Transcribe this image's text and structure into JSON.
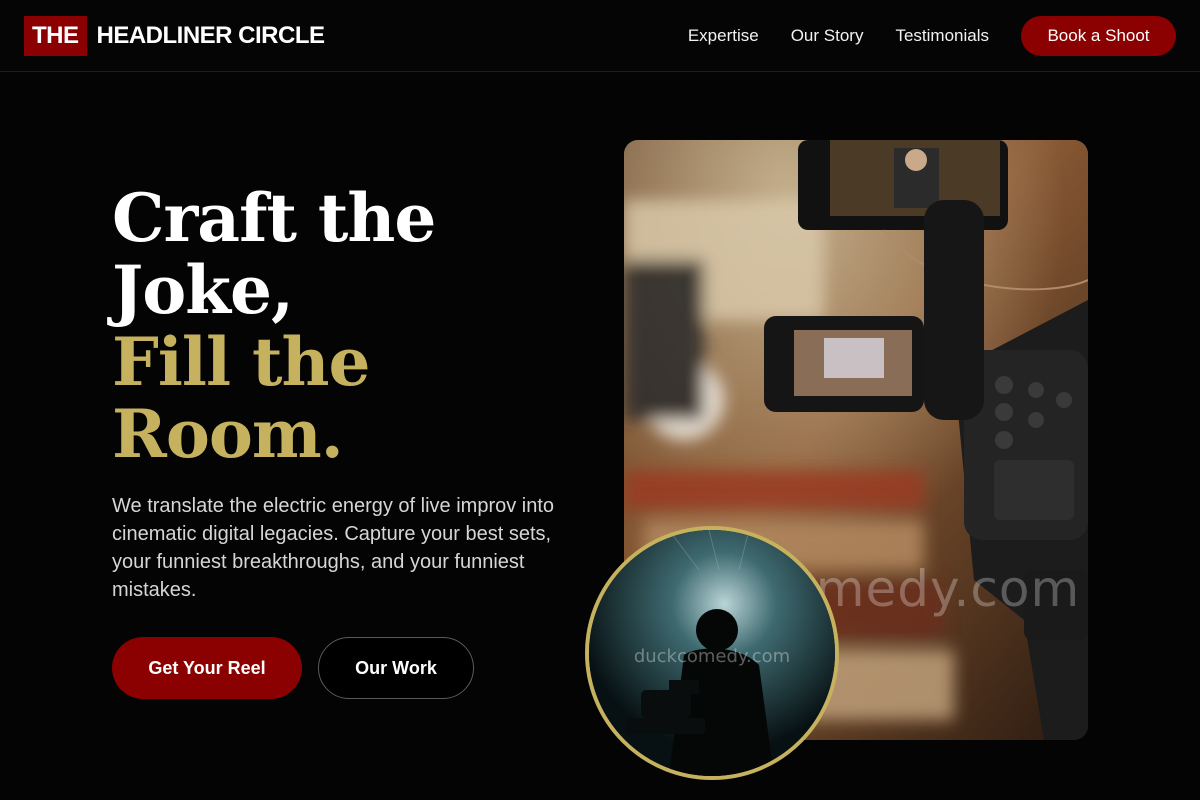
{
  "brand": {
    "badge": "THE",
    "name": "HEADLINER CIRCLE"
  },
  "nav": {
    "links": [
      "Expertise",
      "Our Story",
      "Testimonials"
    ],
    "cta": "Book a Shoot"
  },
  "hero": {
    "headline_white": [
      "Craft the",
      "Joke,"
    ],
    "headline_gold": [
      "Fill the",
      "Room."
    ],
    "subtext": "We translate the electric energy of live improv into cinematic digital legacies. Capture your best sets, your funniest breakthroughs, and your funniest mistakes.",
    "primary_button": "Get Your Reel",
    "secondary_button": "Our Work"
  },
  "images": {
    "main_watermark": "duckcomedy.com",
    "circle_watermark": "duckcomedy.com"
  },
  "colors": {
    "accent_red": "#8b0000",
    "gold": "#c6b15f",
    "background": "#040404"
  }
}
